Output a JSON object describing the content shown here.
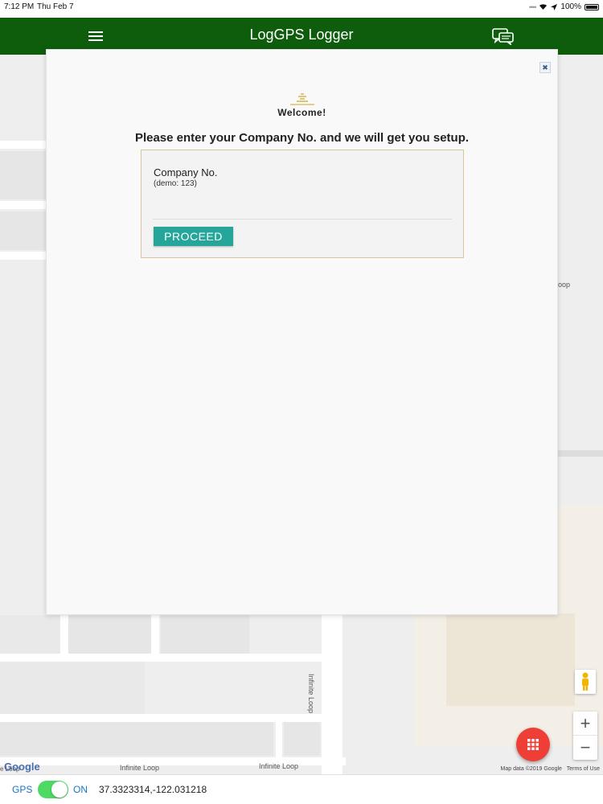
{
  "statusbar": {
    "time": "7:12 PM",
    "date": "Thu Feb 7",
    "battery": "100%"
  },
  "header": {
    "title": "LogGPS Logger",
    "menu_icon": "hamburger-icon",
    "chat_icon": "chat-icon"
  },
  "modal": {
    "close_icon": "close-icon",
    "welcome": "Welcome!",
    "instruction": "Please enter your Company No. and we will get you setup.",
    "form": {
      "label": "Company No.",
      "hint": "(demo: 123)",
      "value": "",
      "placeholder": "",
      "proceed_label": "PROCEED"
    }
  },
  "map": {
    "roads": [
      "Infinite Loop",
      "Infinite Loop",
      "Infinite Loop",
      "oop",
      "e Loop"
    ],
    "google": "Google",
    "map_data": "Map data ©2019 Google",
    "terms": "Terms of Use",
    "zoom_in": "+",
    "zoom_out": "−"
  },
  "bottombar": {
    "gps_label": "GPS",
    "toggle_state": "ON",
    "coordinates": "37.3323314,-122.031218"
  },
  "colors": {
    "header": "#0d5d0d",
    "accent": "#26a69a",
    "fab": "#ef3e36",
    "toggle": "#4cd964",
    "link": "#1a73c7"
  }
}
